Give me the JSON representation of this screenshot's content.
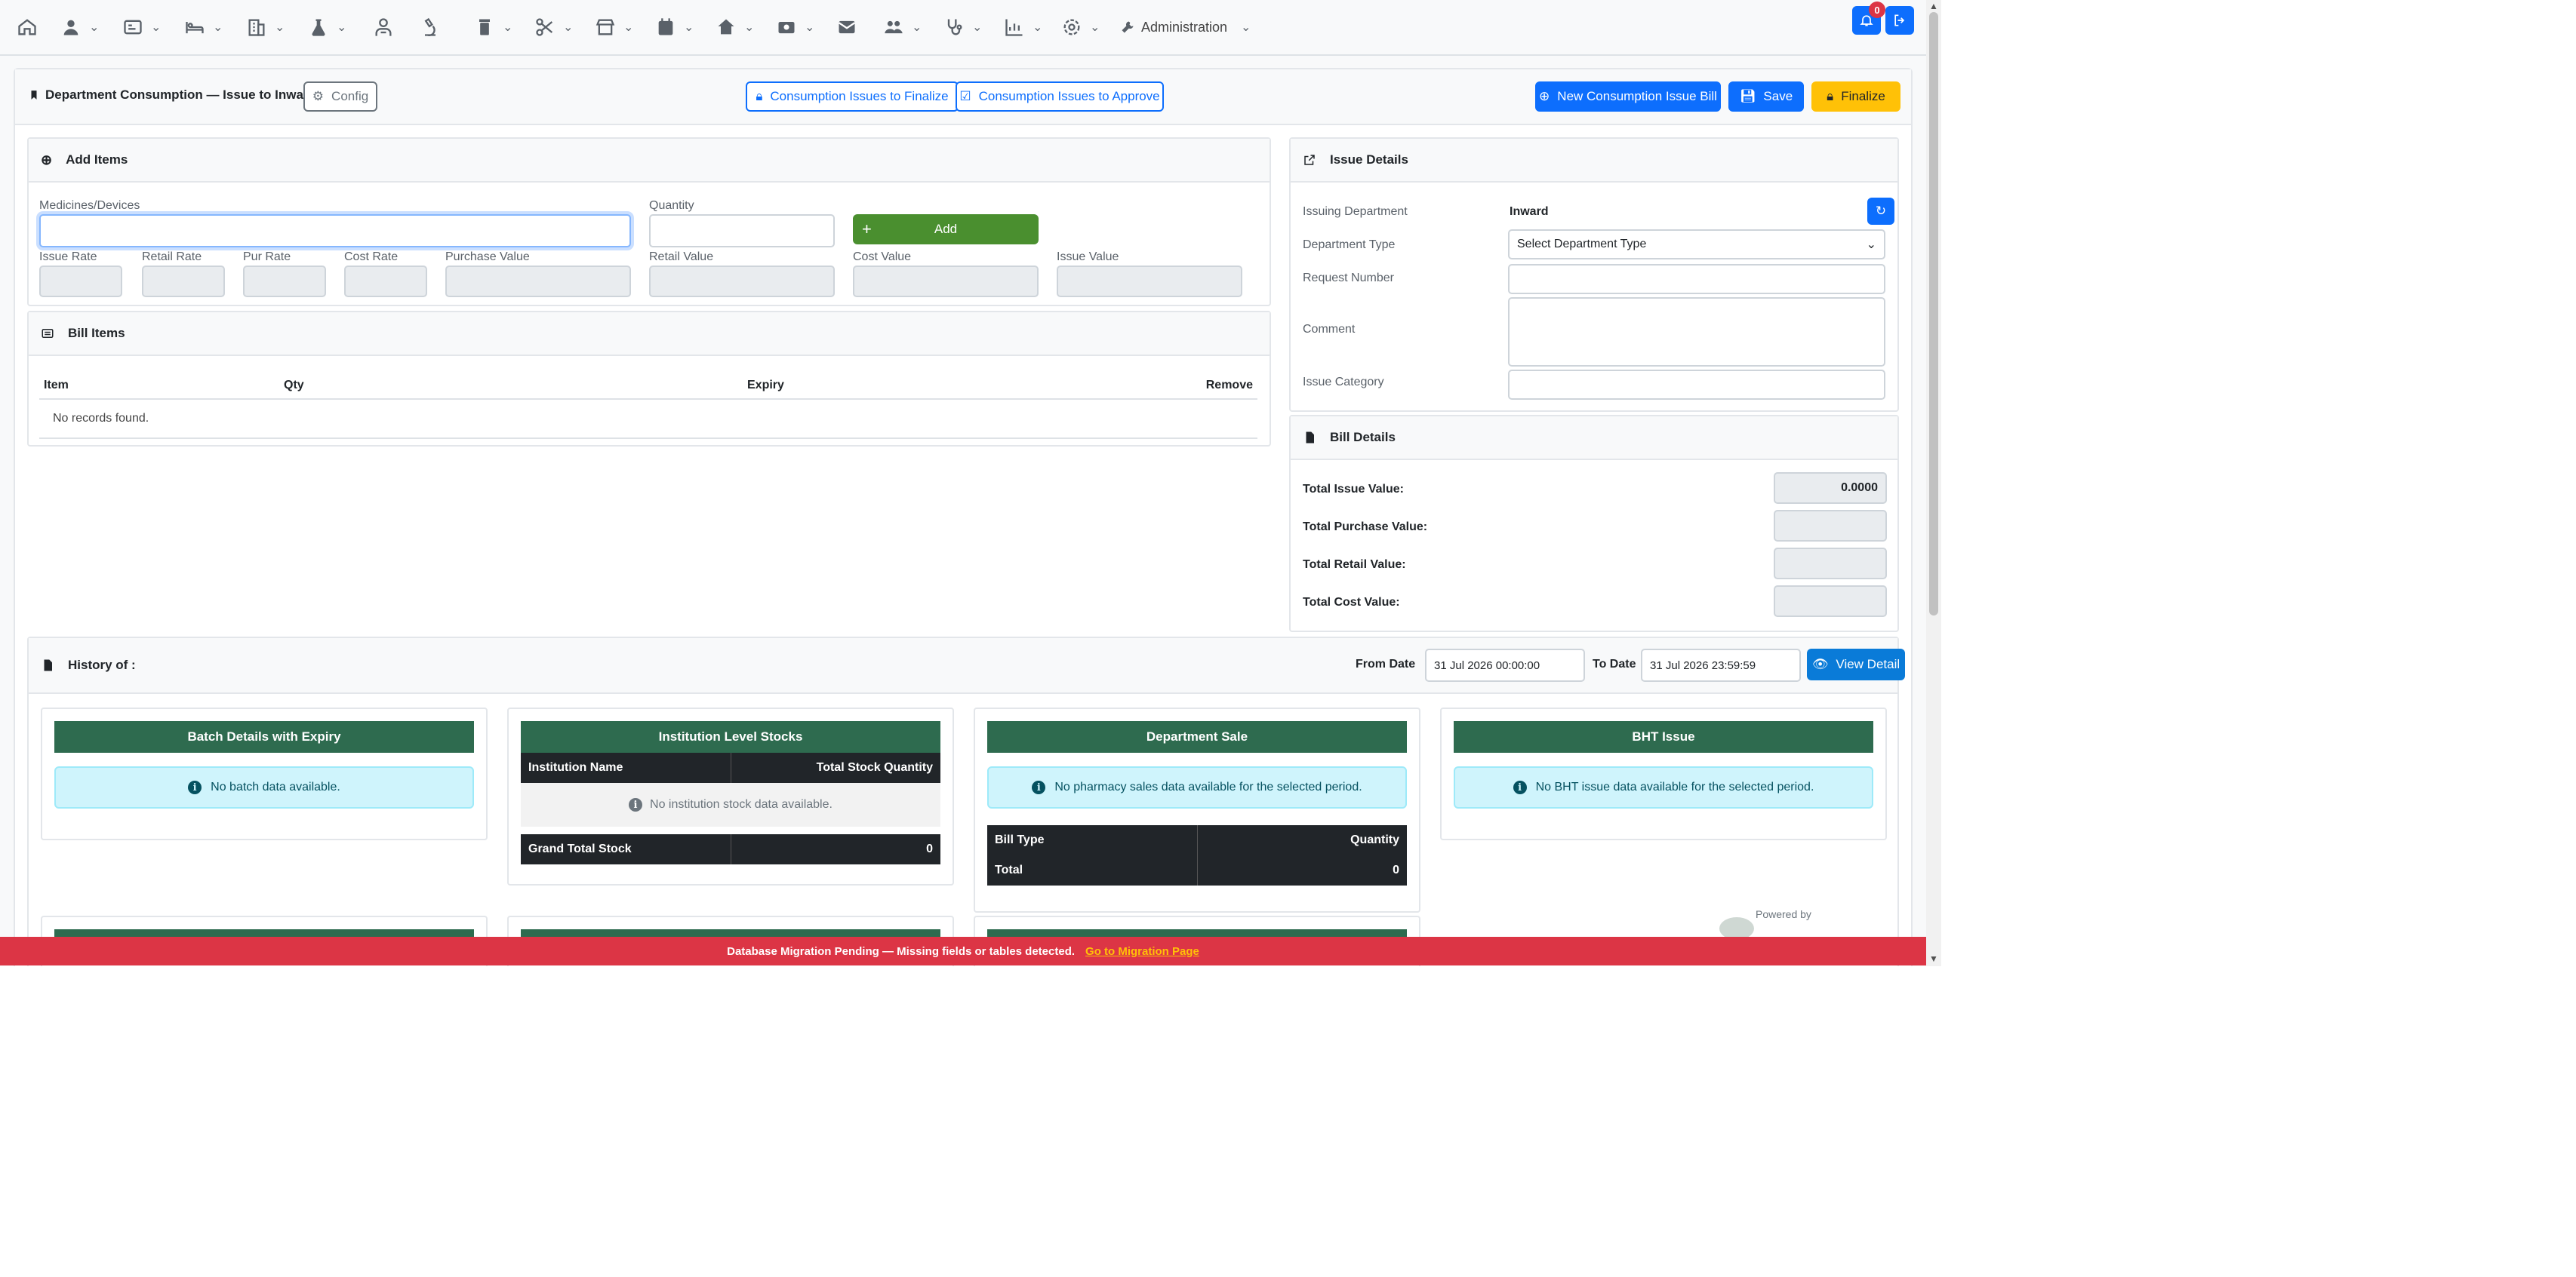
{
  "nav": {
    "items": [
      "home-icon",
      "patient-icon",
      "opd-icon",
      "inward-icon",
      "hospital-icon",
      "lab-icon",
      "doctor-icon",
      "microscope-icon",
      "pharmacy-icon",
      "theatre-icon",
      "store-icon",
      "appointment-icon",
      "clinic-icon",
      "channel-icon",
      "mail-icon",
      "hr-icon",
      "medical-icon",
      "reports-icon",
      "settings-icon"
    ],
    "admin_label": "Administration",
    "notification_count": "0"
  },
  "header": {
    "title": "Department Consumption — Issue to Inward",
    "config_label": "Config",
    "finalize_list_label": "Consumption Issues to Finalize",
    "approve_list_label": "Consumption Issues to Approve",
    "new_bill_label": "New Consumption Issue Bill",
    "save_label": "Save",
    "finalize_label": "Finalize"
  },
  "add_items": {
    "title": "Add Items",
    "medicines_label": "Medicines/Devices",
    "quantity_label": "Quantity",
    "add_label": "Add",
    "issue_rate_label": "Issue Rate",
    "retail_rate_label": "Retail Rate",
    "pur_rate_label": "Pur Rate",
    "cost_rate_label": "Cost Rate",
    "purchase_value_label": "Purchase Value",
    "retail_value_label": "Retail Value",
    "cost_value_label": "Cost Value",
    "issue_value_label": "Issue Value"
  },
  "bill_items": {
    "title": "Bill Items",
    "columns": [
      "Item",
      "Qty",
      "Expiry",
      "Remove"
    ],
    "empty": "No records found."
  },
  "issue_details": {
    "title": "Issue Details",
    "issuing_department_label": "Issuing Department",
    "issuing_department_value": "Inward",
    "department_type_label": "Department Type",
    "department_type_value": "Select Department Type",
    "request_number_label": "Request Number",
    "comment_label": "Comment",
    "issue_category_label": "Issue Category"
  },
  "bill_details": {
    "title": "Bill Details",
    "total_issue_label": "Total Issue Value:",
    "total_issue_value": "0.0000",
    "total_purchase_label": "Total Purchase Value:",
    "total_retail_label": "Total Retail Value:",
    "total_cost_label": "Total Cost Value:"
  },
  "history": {
    "title": "History of :",
    "from_label": "From Date",
    "from_value": "31 Jul 2026 00:00:00",
    "to_label": "To Date",
    "to_value": "31 Jul 2026 23:59:59",
    "view_detail_label": "View Detail",
    "batch": {
      "title": "Batch Details with Expiry",
      "empty": "No batch data available."
    },
    "institution": {
      "title": "Institution Level Stocks",
      "col1": "Institution Name",
      "col2": "Total Stock Quantity",
      "empty": "No institution stock data available.",
      "total_label": "Grand Total Stock",
      "total_value": "0"
    },
    "dept_sale": {
      "title": "Department Sale",
      "empty": "No pharmacy sales data available for the selected period.",
      "col1": "Bill Type",
      "col2": "Quantity",
      "total_label": "Total",
      "total_value": "0"
    },
    "bht": {
      "title": "BHT Issue",
      "empty": "No BHT issue data available for the selected period."
    },
    "powered_by": "Powered by"
  },
  "footer": {
    "message": "Database Migration Pending — Missing fields or tables detected.",
    "link": "Go to Migration Page"
  },
  "colors": {
    "primary": "#0d6efd",
    "warning": "#ffc107",
    "success": "#4a8f2f",
    "danger": "#dc3545",
    "header_green": "#2e6b4f"
  }
}
